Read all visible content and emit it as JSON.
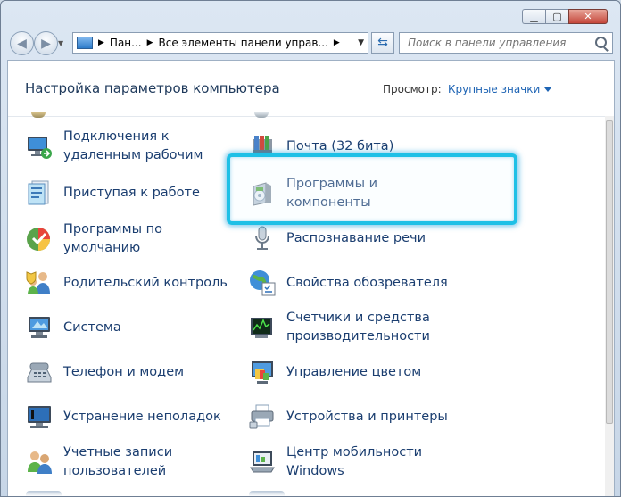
{
  "toolbar": {
    "breadcrumbs": [
      "Пан...",
      "Все элементы панели управ..."
    ],
    "search_placeholder": "Поиск в панели управления"
  },
  "header": {
    "title": "Настройка параметров компьютера",
    "view_label": "Просмотр:",
    "view_value": "Крупные значки"
  },
  "items": {
    "left": [
      {
        "label": "Подключения к\nудаленным рабочим",
        "icon": "remote-desktop-icon"
      },
      {
        "label": "Приступая к работе",
        "icon": "getting-started-icon"
      },
      {
        "label": "Программы по\nумолчанию",
        "icon": "default-programs-icon"
      },
      {
        "label": "Родительский контроль",
        "icon": "parental-controls-icon"
      },
      {
        "label": "Система",
        "icon": "system-icon"
      },
      {
        "label": "Телефон и модем",
        "icon": "phone-modem-icon"
      },
      {
        "label": "Устранение неполадок",
        "icon": "troubleshooting-icon"
      },
      {
        "label": "Учетные записи\nпользователей",
        "icon": "user-accounts-icon"
      }
    ],
    "right": [
      {
        "label": "Почта (32 бита)",
        "icon": "mail-icon"
      },
      {
        "label": "Программы и\nкомпоненты",
        "icon": "programs-features-icon"
      },
      {
        "label": "Распознавание речи",
        "icon": "speech-recognition-icon"
      },
      {
        "label": "Свойства обозревателя",
        "icon": "internet-options-icon"
      },
      {
        "label": "Счетчики и средства\nпроизводительности",
        "icon": "performance-icon"
      },
      {
        "label": "Управление цветом",
        "icon": "color-management-icon"
      },
      {
        "label": "Устройства и принтеры",
        "icon": "devices-printers-icon"
      },
      {
        "label": "Центр мобильности\nWindows",
        "icon": "mobility-center-icon"
      }
    ]
  },
  "highlight_color": "#1ec0e6"
}
